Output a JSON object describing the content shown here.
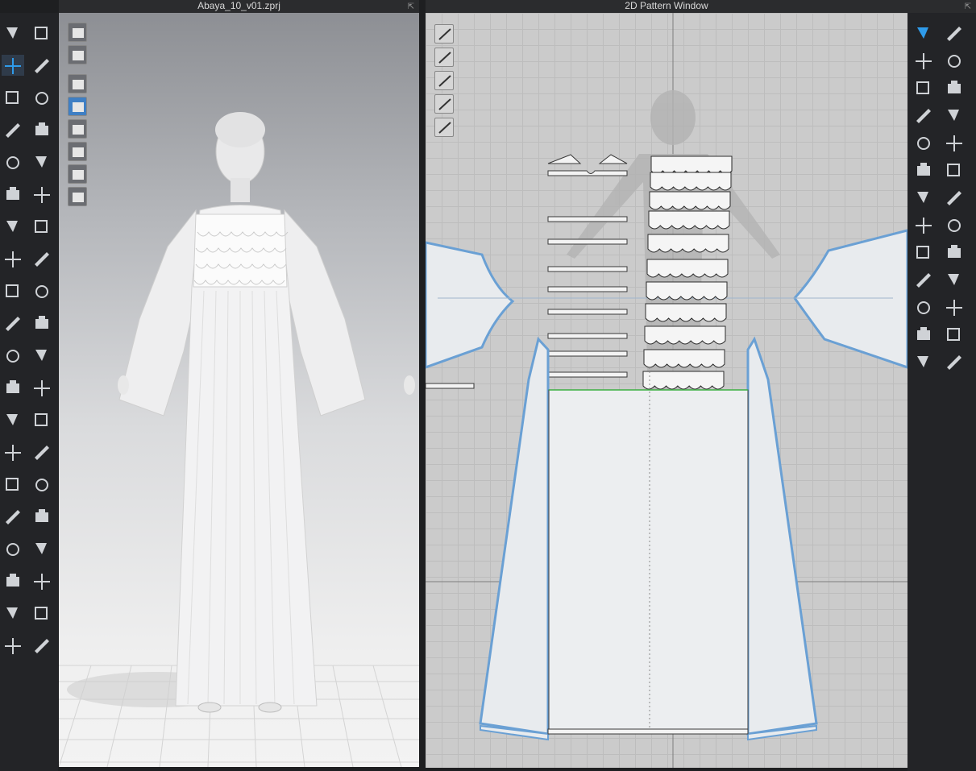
{
  "viewport3d": {
    "title": "Abaya_10_v01.zprj"
  },
  "pattern_window": {
    "title": "2D Pattern Window"
  },
  "colors": {
    "app_bg": "#1e1f21",
    "toolbar_bg": "#232427",
    "title_bg": "#2b2c2e",
    "pattern_bg": "#cbcbcb",
    "piece_fill": "#e8ebee",
    "selected_outline": "#6aa0d4",
    "active_tool": "#2f9bea",
    "seam_green": "#3cb043"
  },
  "left_tools": [
    "simulation-icon",
    "select-move-icon",
    "edit-pattern-icon",
    "garment-fit-icon",
    "fold-arrangement-icon",
    "pin-icon",
    "tack-icon",
    "brush-icon",
    "measure-icon",
    "button-icon",
    "zipper-icon",
    "trim-icon",
    "avatar-icon",
    "hanger-icon",
    "sewing-icon",
    "puckering-icon",
    "tape-icon",
    "ruler-icon",
    "layer-icon",
    "shirt-icon"
  ],
  "right_tools": [
    "transform-pattern-icon",
    "edit-point-icon",
    "polygon-icon",
    "rectangle-icon",
    "internal-polygon-icon",
    "trace-icon",
    "fold-icon",
    "cut-icon",
    "notch-icon",
    "pleat-icon",
    "text-icon",
    "grading-icon",
    "symmetry-icon"
  ],
  "view3d_side_buttons": [
    "render-mode-icon",
    "garment-display-icon",
    "avatar-display-icon",
    "texture-icon",
    "skin-icon",
    "shading-icon",
    "avatar-face-icon",
    "globe-icon"
  ],
  "pattern_side_buttons": [
    "pen-tool-icon",
    "shirt-display-icon",
    "info-icon",
    "layer-display-icon",
    "lock-icon"
  ]
}
